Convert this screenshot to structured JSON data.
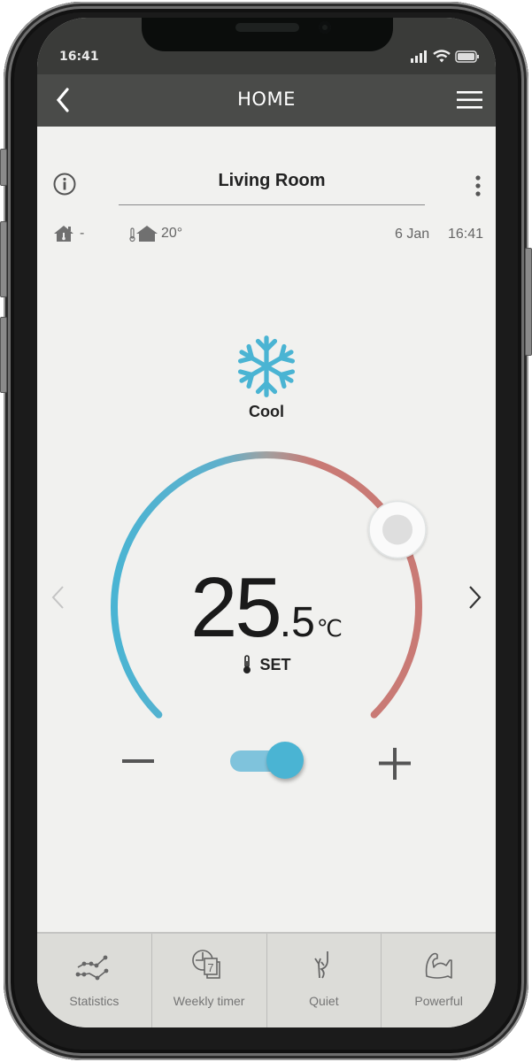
{
  "status_bar": {
    "time": "16:41",
    "icons": [
      "signal-icon",
      "wifi-icon",
      "battery-icon"
    ]
  },
  "nav": {
    "title": "HOME",
    "back_icon": "chevron-left-icon",
    "menu_icon": "hamburger-menu-icon"
  },
  "room": {
    "name": "Living Room",
    "info_icon": "info-icon",
    "more_icon": "kebab-menu-icon"
  },
  "readings": {
    "outdoor_temp": "-",
    "indoor_temp": "20°",
    "date": "6 Jan",
    "time": "16:41"
  },
  "mode": {
    "label": "Cool",
    "icon": "snowflake-icon"
  },
  "setpoint": {
    "integer": "25",
    "decimal": ".5",
    "unit": "℃",
    "label": "SET",
    "dial_fraction": 0.72
  },
  "controls": {
    "power_on": true
  },
  "colors": {
    "cool": "#4ab4d3",
    "warm": "#c97a75",
    "navbar": "#4a4b49",
    "background": "#f1f1ef",
    "bottom_bar": "#dcdcd8"
  },
  "bottom_tabs": [
    {
      "label": "Statistics",
      "icon": "statistics-chart-icon"
    },
    {
      "label": "Weekly timer",
      "icon": "weekly-timer-icon"
    },
    {
      "label": "Quiet",
      "icon": "quiet-icon"
    },
    {
      "label": "Powerful",
      "icon": "powerful-arm-icon"
    }
  ]
}
